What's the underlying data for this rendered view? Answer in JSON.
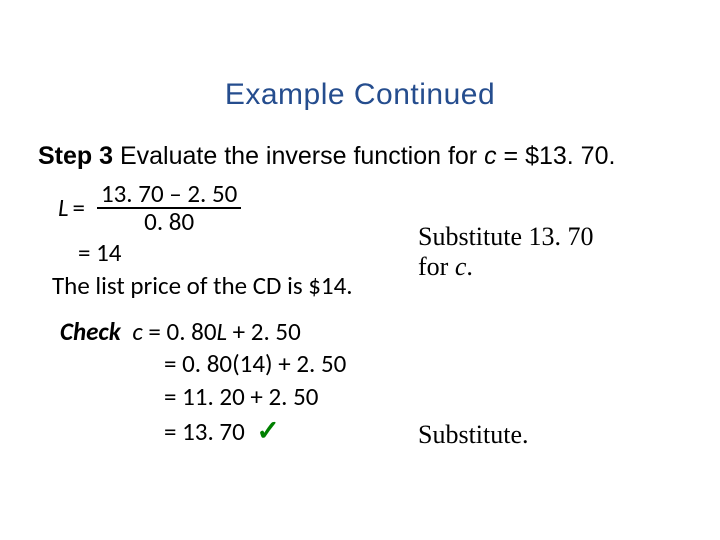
{
  "title": "Example Continued",
  "step": {
    "label": "Step 3",
    "text_before_var": "  Evaluate the inverse function for ",
    "var": "c",
    "text_after_var": " = $13. 70."
  },
  "work": {
    "lvar": "L",
    "eq": "=",
    "numer": "13. 70 – 2. 50",
    "denom": "0. 80",
    "result": "= 14",
    "conclusion": "The list price of the CD is $14."
  },
  "note1": {
    "line1a": "Substitute 13. 70",
    "line2a": "for ",
    "var": "c",
    "line2b": "."
  },
  "check": {
    "label": "Check",
    "line1_pre": "  ",
    "line1_c": "c",
    "line1_mid": " = 0. 80",
    "line1_l": "L",
    "line1_post": " + 2. 50",
    "line2": "= 0. 80(14) + 2. 50",
    "line3": "= 11. 20 + 2. 50",
    "line4": "= 13. 70",
    "tick": "✓"
  },
  "note2": "Substitute."
}
